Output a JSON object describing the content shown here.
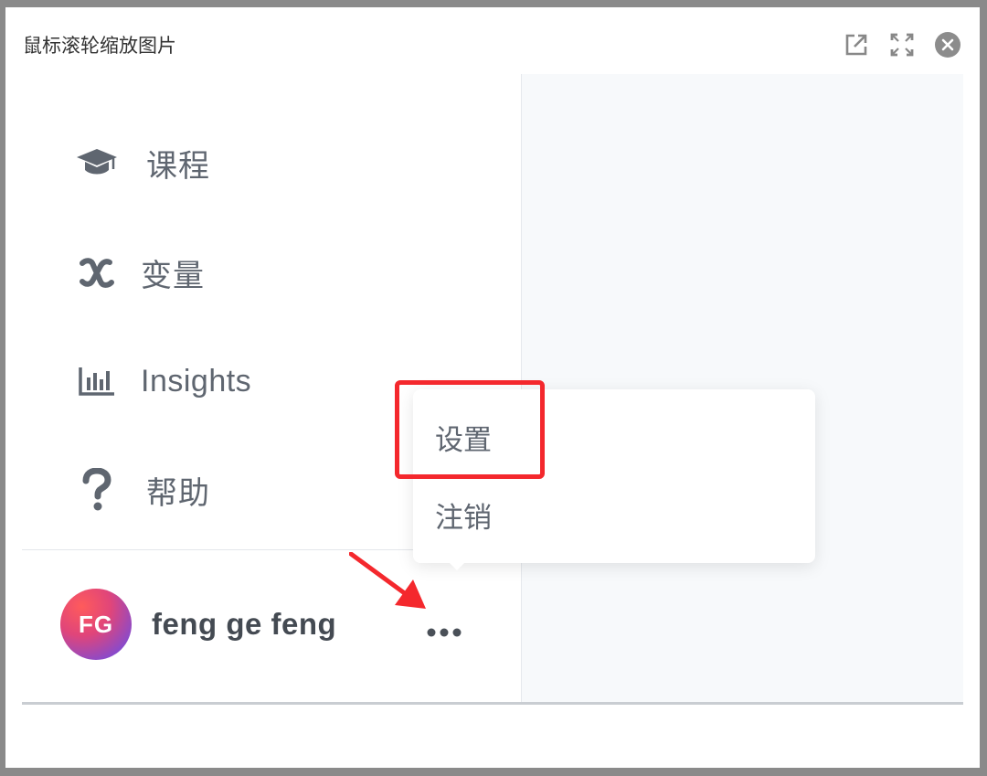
{
  "window": {
    "title": "鼠标滚轮缩放图片",
    "buttons": {
      "open_external_icon": "open-external-icon",
      "fullscreen_icon": "fullscreen-icon",
      "close_icon": "close-icon"
    }
  },
  "sidebar": {
    "items": [
      {
        "label": "课程",
        "icon": "graduation-cap-icon"
      },
      {
        "label": "变量",
        "icon": "variable-x-icon"
      },
      {
        "label": "Insights",
        "icon": "bar-chart-icon"
      },
      {
        "label": "帮助",
        "icon": "question-mark-icon"
      }
    ]
  },
  "user": {
    "initials": "FG",
    "name": "feng ge feng",
    "more_icon": "more-dots-icon"
  },
  "popup_menu": {
    "items": [
      {
        "label": "设置"
      },
      {
        "label": "注销"
      }
    ]
  },
  "colors": {
    "highlight": "#f4282d",
    "nav_text": "#5f6670",
    "avatar_gradient_start": "#ff5b5b",
    "avatar_gradient_end": "#7b4bd8"
  }
}
